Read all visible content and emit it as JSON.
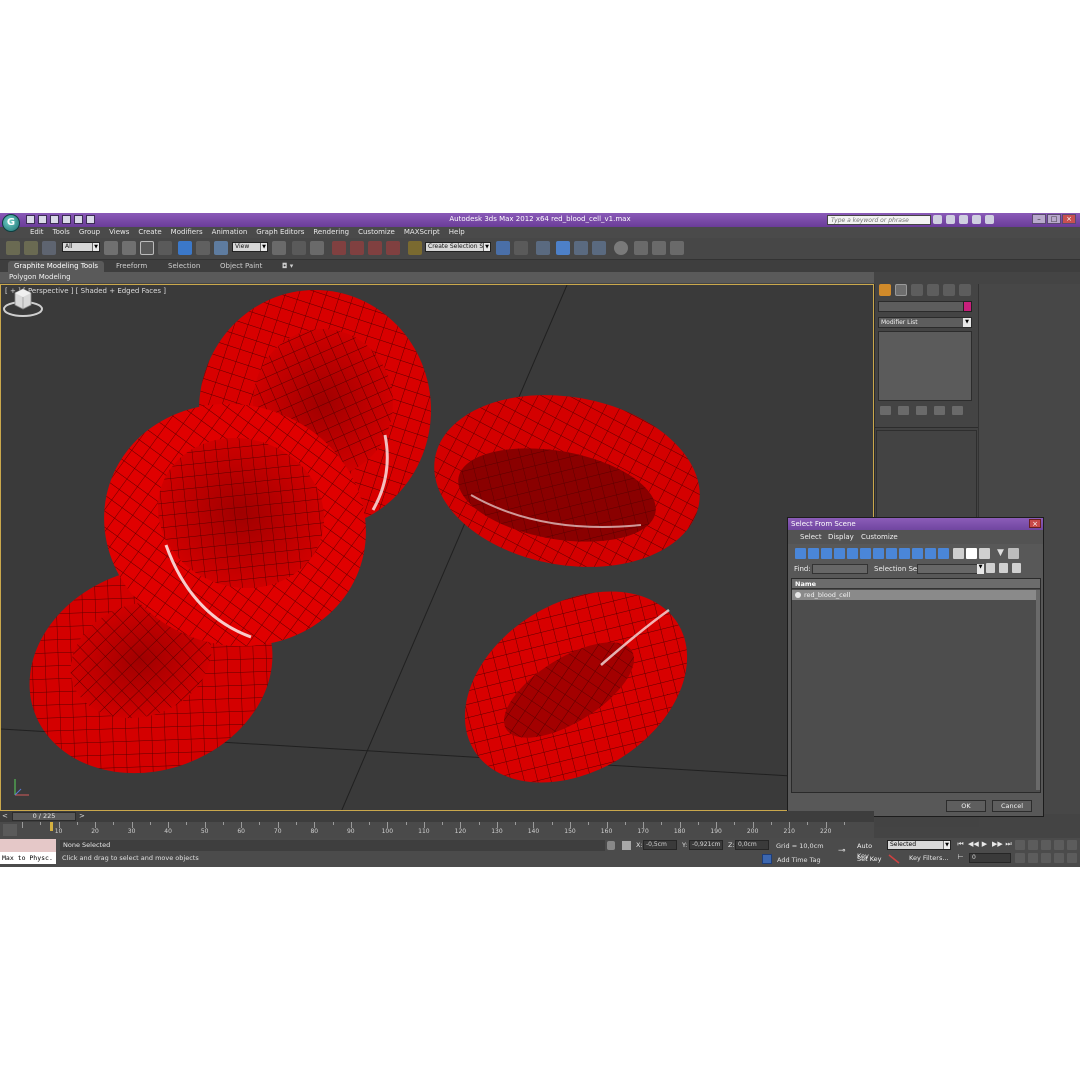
{
  "titlebar": {
    "title": "Autodesk 3ds Max  2012 x64     red_blood_cell_v1.max",
    "search_placeholder": "Type a keyword or phrase",
    "logo_icon": "3dsmax-logo-icon"
  },
  "menu": {
    "items": [
      "Edit",
      "Tools",
      "Group",
      "Views",
      "Create",
      "Modifiers",
      "Animation",
      "Graph Editors",
      "Rendering",
      "Customize",
      "MAXScript",
      "Help"
    ]
  },
  "toolbar": {
    "selection_filter": "All",
    "reference_coord": "View",
    "named_selection_set": "Create Selection Se"
  },
  "ribbon": {
    "tabs": [
      "Graphite Modeling Tools",
      "Freeform",
      "Selection",
      "Object Paint"
    ],
    "active_tab": "Graphite Modeling Tools",
    "subpanel": "Polygon Modeling"
  },
  "viewport": {
    "label": "[ + ] [ Perspective ] [ Shaded + Edged Faces ]",
    "object_color": "#d80000",
    "background": "#3a3a3a"
  },
  "command_panel": {
    "modifier_list": "Modifier List",
    "color_swatch": "#c8207c"
  },
  "dialog": {
    "title": "Select From Scene",
    "menu": [
      "Select",
      "Display",
      "Customize"
    ],
    "find_label": "Find:",
    "selection_set_label": "Selection Set:",
    "column_name": "Name",
    "rows": [
      "red_blood_cell"
    ],
    "ok": "OK",
    "cancel": "Cancel"
  },
  "timeline": {
    "frame_display": "0 / 225",
    "prev": "<",
    "next": ">",
    "ruler_labels": [
      "10",
      "20",
      "30",
      "40",
      "50",
      "60",
      "70",
      "80",
      "90",
      "100",
      "110",
      "120",
      "130",
      "140",
      "150",
      "160",
      "170",
      "180",
      "190",
      "200",
      "210",
      "220"
    ]
  },
  "status": {
    "maxscript_text": "Max to Physc.",
    "selection": "None Selected",
    "prompt": "Click and drag to select and move objects",
    "x_label": "X:",
    "x_value": "-0,5cm",
    "y_label": "Y:",
    "y_value": "-0,921cm",
    "z_label": "Z:",
    "z_value": "0,0cm",
    "grid": "Grid = 10,0cm",
    "add_time_tag": "Add Time Tag",
    "auto_key": "Auto Key",
    "set_key": "Set Key",
    "key_mode": "Selected",
    "key_filters": "Key Filters...",
    "current_frame": "0"
  }
}
